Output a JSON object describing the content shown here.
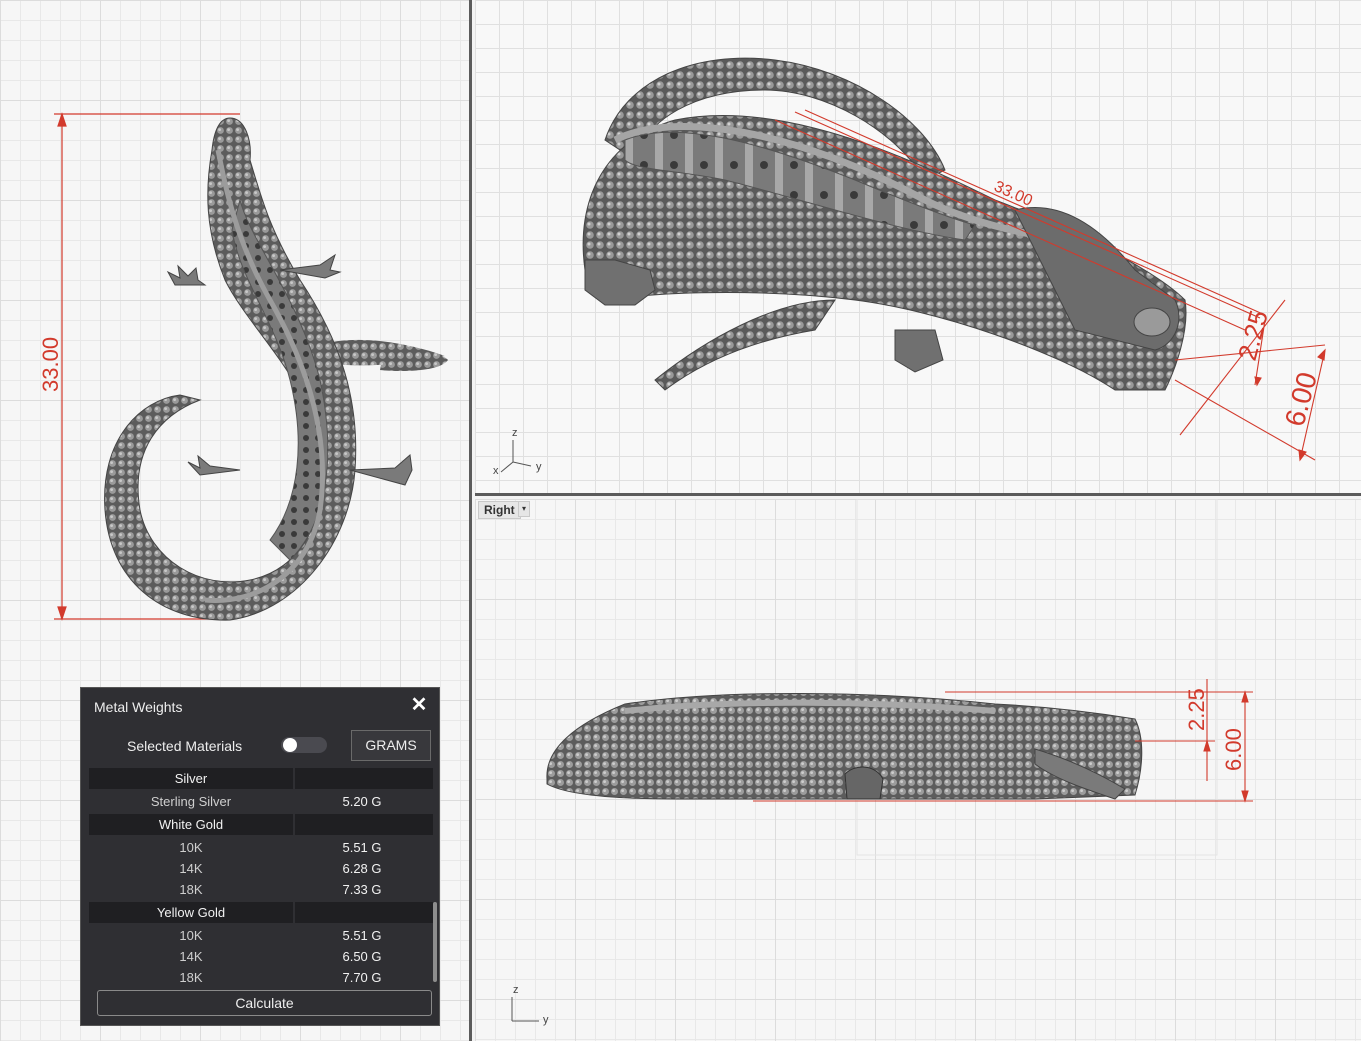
{
  "viewports": {
    "top": {
      "dimension": "33.00"
    },
    "perspective": {
      "dimension_length": "33.00",
      "dimension_small": "2.25",
      "dimension_height": "6.00",
      "axes": {
        "x": "x",
        "y": "y",
        "z": "z"
      }
    },
    "right": {
      "label": "Right",
      "dimension_small": "2.25",
      "dimension_height": "6.00",
      "axes": {
        "y": "y",
        "z": "z"
      }
    }
  },
  "panel": {
    "title": "Metal Weights",
    "close_icon": "close-icon",
    "selected_materials_label": "Selected Materials",
    "units_button": "GRAMS",
    "groups": [
      {
        "name": "Silver",
        "items": [
          {
            "label": "Sterling Silver",
            "value": "5.20 G"
          }
        ]
      },
      {
        "name": "White Gold",
        "items": [
          {
            "label": "10K",
            "value": "5.51 G"
          },
          {
            "label": "14K",
            "value": "6.28 G"
          },
          {
            "label": "18K",
            "value": "7.33 G"
          }
        ]
      },
      {
        "name": "Yellow Gold",
        "items": [
          {
            "label": "10K",
            "value": "5.51 G"
          },
          {
            "label": "14K",
            "value": "6.50 G"
          },
          {
            "label": "18K",
            "value": "7.70 G"
          }
        ]
      }
    ],
    "calculate_button": "Calculate"
  },
  "colors": {
    "dimension": "#d23a2c",
    "panel_bg": "#2f2f33",
    "model": "#6e6e6e"
  }
}
